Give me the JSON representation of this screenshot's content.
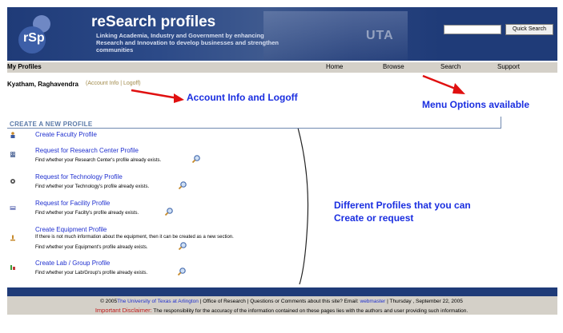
{
  "header": {
    "logo_text": "rSp",
    "title": "reSearch profiles",
    "tagline": "Linking Academia, Industry and Government by enhancing Research and Innovation to develop businesses and strengthen communities",
    "watermark": "UTA",
    "search": {
      "placeholder": "",
      "button_label": "Quick Search"
    }
  },
  "nav": {
    "section_label": "My Profiles",
    "items": [
      "Home",
      "Browse",
      "Search",
      "Support"
    ]
  },
  "user": {
    "name": "Kyatham, Raghavendra",
    "links": "(Account Info | Logoff)"
  },
  "annotations": {
    "account": "Account Info and Logoff",
    "menu": "Menu Options available",
    "profiles_line1": "Different Profiles that you can",
    "profiles_line2": "Create or request"
  },
  "section": {
    "title": "CREATE A NEW PROFILE",
    "items": [
      {
        "label": "Create Faculty Profile",
        "note": "",
        "icon": "person-icon"
      },
      {
        "label": "Request for Research Center Profile",
        "note": "Find whether your Research Center's profile already exists.",
        "icon": "building-icon"
      },
      {
        "label": "Request for Technology Profile",
        "note": "Find whether your Technology's profile already exists.",
        "icon": "gear-icon"
      },
      {
        "label": "Request for Facility Profile",
        "note": "Find whether your Facilty's profile already exists.",
        "icon": "facility-icon"
      },
      {
        "label": "Create Equipment Profile",
        "note": "Find whether your Equipment's profile already exists.",
        "icon": "microscope-icon",
        "extra": "If there is not much information about the equipment, then it can be created as a new section."
      },
      {
        "label": "Create Lab / Group Profile",
        "note": "Find whether your Lab/Group's profile already exists.",
        "icon": "lab-icon"
      }
    ]
  },
  "footer": {
    "line1_prefix": "© 2005",
    "university": "The University of Texas at Arlington",
    "line1_mid": " | Office of Research | Questions or Comments about this site? Email: ",
    "webmaster": "webmaster",
    "line1_suffix": " | Thursday , September 22, 2005",
    "disclaimer_label": "Important Disclaimer:",
    "disclaimer_text": " The responsibility for the accuracy of the information contained on these pages lies with the authors and user providing such information."
  },
  "colors": {
    "header_bg": "#1f3b78",
    "nav_bg": "#d4d0c8",
    "link": "#1f2fcf",
    "annotation": "#1a2ee0",
    "arrow": "#e01010",
    "disclaimer": "#c01818"
  }
}
